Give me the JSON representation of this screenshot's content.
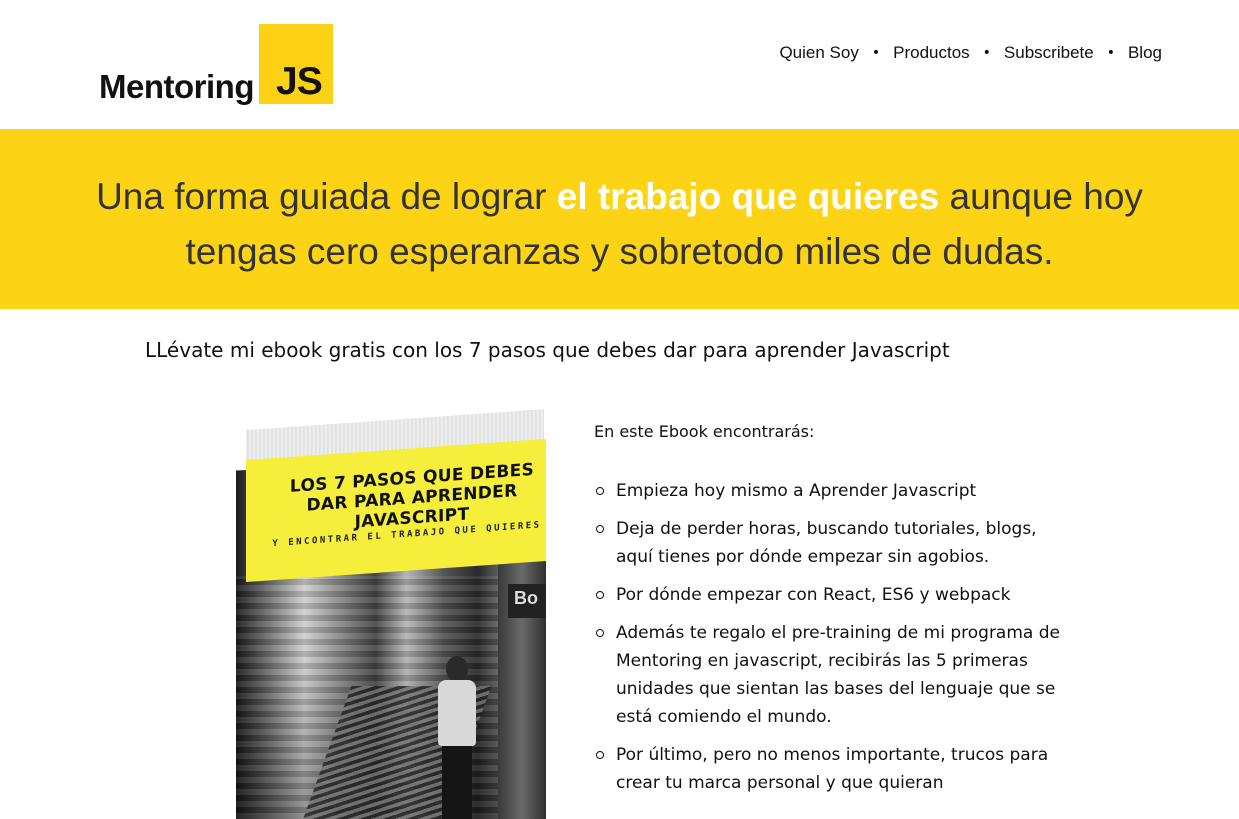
{
  "header": {
    "logo_text": "Mentoring",
    "logo_badge": "JS",
    "nav": [
      "Quien Soy",
      "Productos",
      "Subscribete",
      "Blog"
    ],
    "nav_separator": "•"
  },
  "banner": {
    "text_before": "Una forma guiada de lograr ",
    "text_highlight": "el trabajo que quieres",
    "text_after": " aunque hoy tengas cero esperanzas y sobretodo miles de dudas."
  },
  "subtitle": "LLévate mi ebook gratis con los 7 pasos que debes dar para aprender Javascript",
  "book": {
    "title": "LOS 7 PASOS QUE DEBES DAR PARA APRENDER JAVASCRIPT",
    "subtitle": "Y ENCONTRAR EL TRABAJO QUE QUIERES",
    "sign_text": "Bo"
  },
  "content": {
    "intro": "En este Ebook encontrarás:",
    "bullets": [
      "Empieza hoy mismo a Aprender Javascript",
      "Deja de perder horas, buscando tutoriales, blogs, aquí tienes por dónde empezar sin agobios.",
      "Por dónde empezar con React, ES6 y webpack",
      "Además te regalo el pre-training de mi programa de Mentoring en javascript, recibirás las 5 primeras unidades que sientan las bases del lenguaje que se está comiendo el mundo.",
      "Por último, pero no menos importante, trucos para crear tu marca personal y que quieran"
    ]
  },
  "colors": {
    "brand_yellow": "#fdd415",
    "book_banner_yellow": "#f5ee3b",
    "text_dark": "#111111",
    "banner_highlight": "#ffffff"
  }
}
